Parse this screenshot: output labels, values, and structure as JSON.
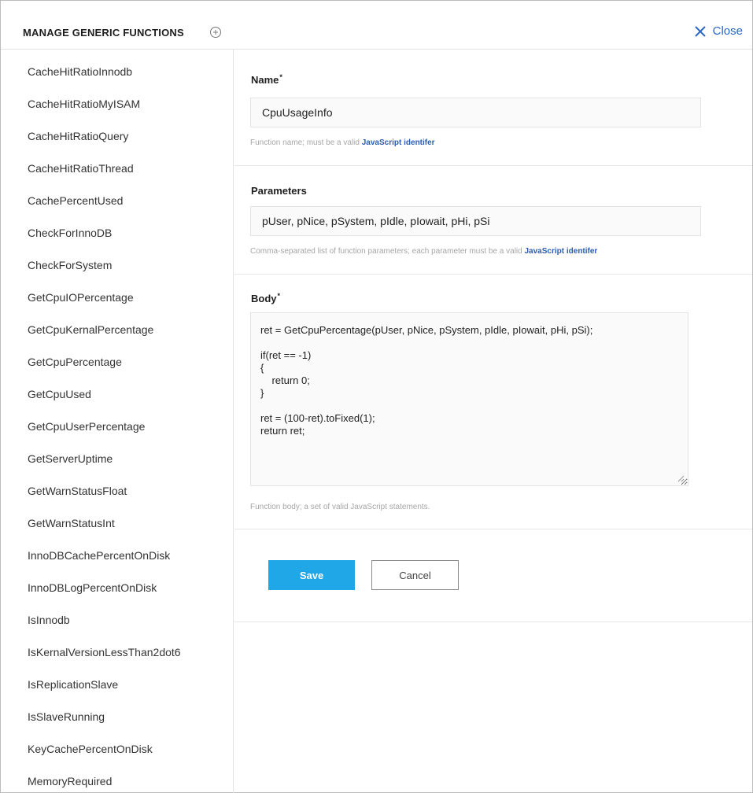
{
  "header": {
    "title": "MANAGE GENERIC FUNCTIONS",
    "add_icon": "circle-plus-icon",
    "close_icon": "x-icon",
    "close_label": "Close"
  },
  "sidebar": {
    "items": [
      {
        "label": "CacheHitRatioInnodb"
      },
      {
        "label": "CacheHitRatioMyISAM"
      },
      {
        "label": "CacheHitRatioQuery"
      },
      {
        "label": "CacheHitRatioThread"
      },
      {
        "label": "CachePercentUsed"
      },
      {
        "label": "CheckForInnoDB"
      },
      {
        "label": "CheckForSystem"
      },
      {
        "label": "GetCpuIOPercentage"
      },
      {
        "label": "GetCpuKernalPercentage"
      },
      {
        "label": "GetCpuPercentage"
      },
      {
        "label": "GetCpuUsed"
      },
      {
        "label": "GetCpuUserPercentage"
      },
      {
        "label": "GetServerUptime"
      },
      {
        "label": "GetWarnStatusFloat"
      },
      {
        "label": "GetWarnStatusInt"
      },
      {
        "label": "InnoDBCachePercentOnDisk"
      },
      {
        "label": "InnoDBLogPercentOnDisk"
      },
      {
        "label": "IsInnodb"
      },
      {
        "label": "IsKernalVersionLessThan2dot6"
      },
      {
        "label": "IsReplicationSlave"
      },
      {
        "label": "IsSlaveRunning"
      },
      {
        "label": "KeyCachePercentOnDisk"
      },
      {
        "label": "MemoryRequired"
      }
    ]
  },
  "form": {
    "name": {
      "label": "Name",
      "required_mark": "*",
      "value": "CpuUsageInfo",
      "help_text": "Function name; must be a valid ",
      "help_link": "JavaScript identifer"
    },
    "parameters": {
      "label": "Parameters",
      "value": "pUser, pNice, pSystem, pIdle, pIowait, pHi, pSi",
      "help_text": "Comma-separated list of function parameters; each parameter must be a valid ",
      "help_link": "JavaScript identifer"
    },
    "body": {
      "label": "Body",
      "required_mark": "*",
      "value": "ret = GetCpuPercentage(pUser, pNice, pSystem, pIdle, pIowait, pHi, pSi);\n\nif(ret == -1)\n{\n    return 0;\n}\n\nret = (100-ret).toFixed(1);\nreturn ret;",
      "help_text": "Function body; a set of valid JavaScript statements."
    },
    "buttons": {
      "save": "Save",
      "cancel": "Cancel"
    }
  },
  "colors": {
    "accent": "#1fa7e8",
    "link": "#2a66c4"
  }
}
